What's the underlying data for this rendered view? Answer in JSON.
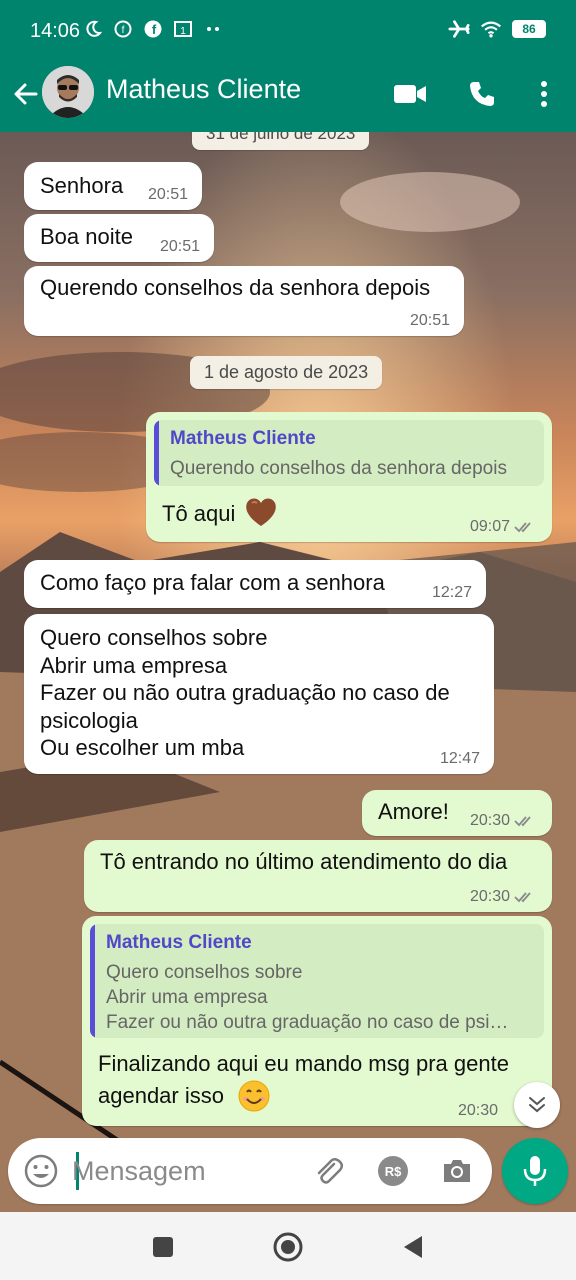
{
  "status_bar": {
    "time": "14:06",
    "battery": "86",
    "left_icons": [
      "moon-icon",
      "facebook-messenger-icon",
      "facebook-icon",
      "notification-1-icon",
      "more-dots-icon"
    ],
    "right_icons": [
      "airplane-icon",
      "wifi-icon",
      "battery-icon"
    ]
  },
  "header": {
    "contact_name": "Matheus Cliente",
    "icons": [
      "back-arrow-icon",
      "avatar",
      "video-call-icon",
      "voice-call-icon",
      "more-vert-icon"
    ]
  },
  "chat": {
    "top_date_partial": "31 de julho de 2023",
    "messages_day1": [
      {
        "dir": "in",
        "text": "Senhora",
        "time": "20:51"
      },
      {
        "dir": "in",
        "text": "Boa noite",
        "time": "20:51"
      },
      {
        "dir": "in",
        "text": "Querendo conselhos da senhora depois",
        "time": "20:51"
      }
    ],
    "date_divider": "1 de agosto de 2023",
    "reply1": {
      "quoted_name": "Matheus Cliente",
      "quoted_text": "Querendo conselhos da senhora depois",
      "text": "Tô aqui",
      "emoji": "heart-emoji",
      "time": "09:07"
    },
    "msg_como": {
      "text": "Como faço pra falar com a senhora",
      "time": "12:27"
    },
    "msg_quero": {
      "lines": [
        "Quero conselhos sobre",
        "Abrir uma empresa",
        "Fazer ou não outra graduação no caso de",
        "psicologia",
        "Ou escolher um mba"
      ],
      "time": "12:47"
    },
    "msg_amore": {
      "text": "Amore!",
      "time": "20:30"
    },
    "msg_entrando": {
      "text": "Tô entrando no último atendimento do dia",
      "time": "20:30"
    },
    "reply2": {
      "quoted_name": "Matheus Cliente",
      "quoted_lines": [
        "Quero conselhos sobre",
        "Abrir uma empresa",
        "Fazer ou não outra graduação no caso de psi…"
      ],
      "text_lines": [
        "Finalizando aqui eu mando msg pra gente",
        "agendar isso"
      ],
      "emoji": "smile-emoji",
      "time": "20:30"
    }
  },
  "composer": {
    "placeholder": "Mensagem",
    "icons": [
      "emoji-icon",
      "attach-icon",
      "pix-rs-icon",
      "camera-icon",
      "mic-icon"
    ],
    "rs_label": "R$"
  },
  "nav": {
    "icons": [
      "recents-icon",
      "home-icon",
      "back-icon"
    ]
  },
  "colors": {
    "header": "#00846e",
    "outgoing": "#e3f9d0",
    "incoming": "#ffffff",
    "quote_bar": "#5a4dd8",
    "mic": "#00a884"
  }
}
